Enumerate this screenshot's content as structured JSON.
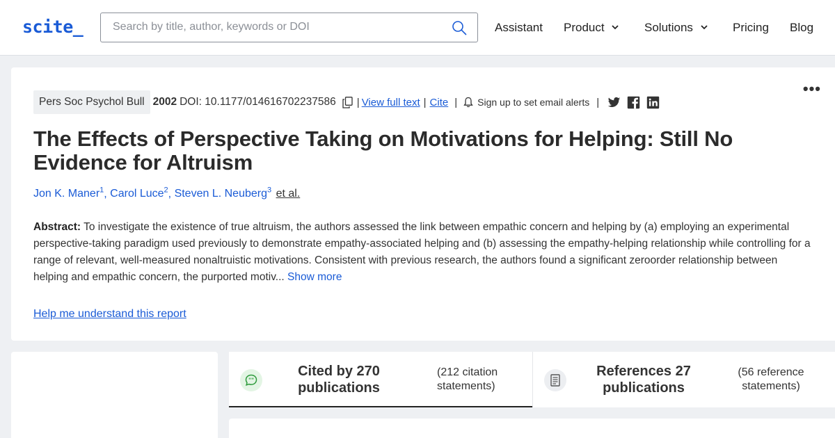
{
  "header": {
    "logo": "scite_",
    "search_placeholder": "Search by title, author, keywords or DOI",
    "nav": {
      "assistant": "Assistant",
      "product": "Product",
      "solutions": "Solutions",
      "pricing": "Pricing",
      "blog": "Blog"
    }
  },
  "paper": {
    "journal": "Pers Soc Psychol Bull",
    "year": "2002",
    "doi": "DOI: 10.1177/014616702237586",
    "view_full_text": "View full text",
    "cite": "Cite",
    "alerts": "Sign up to set email alerts",
    "title": "The Effects of Perspective Taking on Motivations for Helping: Still No Evidence for Altruism",
    "authors": [
      {
        "name": "Jon K. Maner",
        "sup": "1"
      },
      {
        "name": "Carol Luce",
        "sup": "2"
      },
      {
        "name": "Steven L. Neuberg",
        "sup": "3"
      }
    ],
    "et_al": "et al.",
    "abstract_label": "Abstract:",
    "abstract_text": "To investigate the existence of true altruism, the authors assessed the link between empathic concern and helping by (a) employing an experimental perspective-taking paradigm used previously to demonstrate empathy-associated helping and (b) assessing the empathy-helping relationship while controlling for a range of relevant, well-measured nonaltruistic motivations. Consistent with previous research, the authors found a significant zeroorder relationship between helping and empathic concern, the purported motiv...",
    "show_more": "Show more",
    "help_link": "Help me understand this report"
  },
  "tabs": {
    "cited_by": {
      "main": "Cited by 270 publications",
      "line1": "Cited by 270",
      "line2": "publications",
      "sub1": "(212 citation",
      "sub2": "statements)"
    },
    "references": {
      "main": "References 27 publications",
      "line1": "References 27",
      "line2": "publications",
      "sub1": "(56 reference",
      "sub2": "statements)"
    }
  },
  "colors": {
    "brand": "#1a5bd6",
    "cited_icon_bg": "#e3f5e4",
    "cited_icon_fg": "#2e9b3c"
  }
}
